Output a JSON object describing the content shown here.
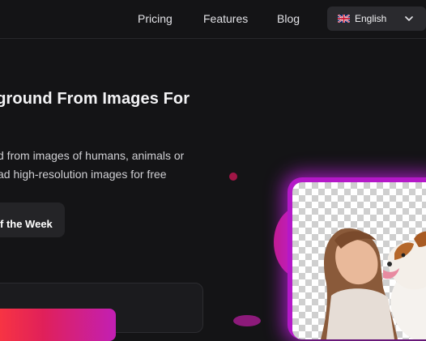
{
  "nav": {
    "links": [
      "Pricing",
      "Features",
      "Blog"
    ],
    "language": {
      "label": "English",
      "icon": "uk-flag-icon"
    }
  },
  "hero": {
    "headline": "kground From Images For",
    "description_lines": [
      "d from images of humans, animals or",
      "ad high-resolution images for free"
    ],
    "promo_button": "f the Week"
  },
  "colors": {
    "background": "#141416",
    "accent_magenta": "#b418c8",
    "upload_gradient_start": "#ff3b3b",
    "upload_gradient_end": "#c21fb4"
  }
}
